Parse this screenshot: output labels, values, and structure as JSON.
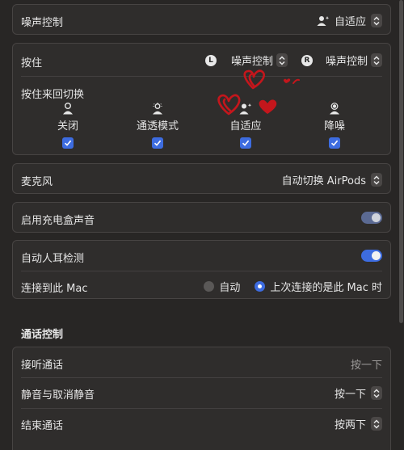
{
  "noise_control": {
    "label": "噪声控制",
    "value": "自适应"
  },
  "press_hold": {
    "label": "按住",
    "left_badge": "L",
    "left_value": "噪声控制",
    "right_badge": "R",
    "right_value": "噪声控制",
    "cycle_label": "按住来回切换",
    "modes": [
      {
        "label": "关闭",
        "checked": true
      },
      {
        "label": "通透模式",
        "checked": true
      },
      {
        "label": "自适应",
        "checked": true
      },
      {
        "label": "降噪",
        "checked": true
      }
    ]
  },
  "microphone": {
    "label": "麦克风",
    "value": "自动切换 AirPods"
  },
  "case_sound": {
    "label": "启用充电盒声音",
    "enabled": true
  },
  "ear_detection": {
    "label": "自动人耳检测",
    "enabled": true
  },
  "connect_mac": {
    "label": "连接到此 Mac",
    "options": [
      {
        "label": "自动",
        "selected": false
      },
      {
        "label": "上次连接的是此 Mac 时",
        "selected": true
      }
    ]
  },
  "call_controls": {
    "title": "通话控制",
    "rows": [
      {
        "label": "接听通话",
        "value": "按一下",
        "has_stepper": false
      },
      {
        "label": "静音与取消静音",
        "value": "按一下",
        "has_stepper": true
      },
      {
        "label": "结束通话",
        "value": "按两下",
        "has_stepper": true
      }
    ]
  },
  "colors": {
    "accent": "#3d6ce0",
    "toggle_dim": "#5b6a93",
    "sticker_red": "#c4161c"
  }
}
